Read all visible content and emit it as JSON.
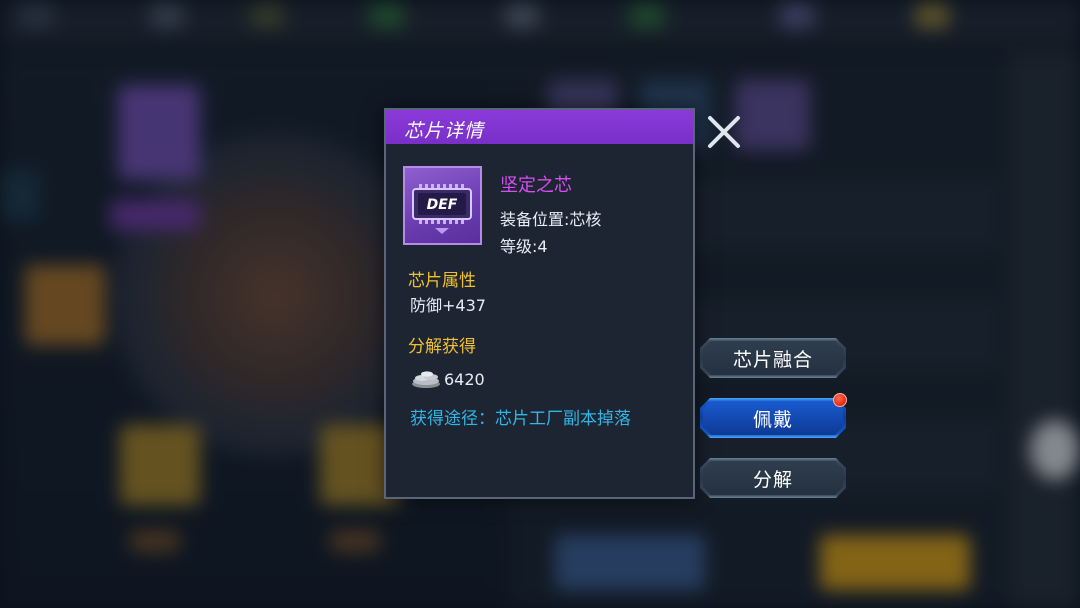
{
  "dialog": {
    "title": "芯片详情",
    "chip": {
      "icon": "def-chip-icon",
      "icon_text": "DEF",
      "name": "坚定之芯",
      "slot": "装备位置:芯核",
      "level": "等级:4"
    },
    "attributes_title": "芯片属性",
    "attribute_value": "防御+437",
    "decompose_title": "分解获得",
    "decompose_reward": {
      "icon": "coin-pile-icon",
      "amount": "6420"
    },
    "obtain_source": "获得途径：芯片工厂副本掉落"
  },
  "close": {
    "icon": "close-x-icon"
  },
  "actions": {
    "fuse_label": "芯片融合",
    "equip_label": "佩戴",
    "decompose_label": "分解"
  },
  "colors": {
    "header_purple": "#7a2fc8",
    "chip_name": "#d64ef0",
    "section_gold": "#f0c030",
    "obtain_cyan": "#32b6e6",
    "equip_blue": "#1656c4",
    "notify_red": "#e02a12"
  }
}
